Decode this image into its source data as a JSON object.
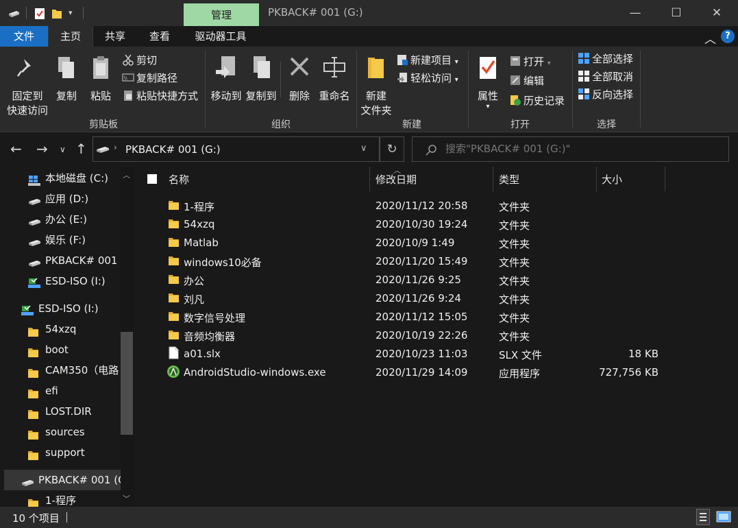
{
  "titlebar": {
    "manage_tab": "管理",
    "title": "PKBACK# 001 (G:)",
    "minimize": "—",
    "maximize": "☐",
    "close": "✕"
  },
  "menu": {
    "tabs": [
      "文件",
      "主页",
      "共享",
      "查看",
      "驱动器工具"
    ],
    "collapse": "^",
    "help": "?"
  },
  "ribbon": {
    "pin_label": "固定到\n快速访问",
    "copy": "复制",
    "paste": "粘贴",
    "cut": "剪切",
    "copy_path": "复制路径",
    "paste_shortcut": "粘贴快捷方式",
    "clipboard_group": "剪贴板",
    "move_to": "移动到",
    "copy_to": "复制到",
    "delete": "删除",
    "rename": "重命名",
    "organize_group": "组织",
    "new_folder": "新建\n文件夹",
    "new_item": "新建项目",
    "easy_access": "轻松访问",
    "new_group": "新建",
    "properties": "属性",
    "open": "打开",
    "edit": "编辑",
    "history": "历史记录",
    "open_group": "打开",
    "select_all": "全部选择",
    "select_none": "全部取消",
    "invert_selection": "反向选择",
    "select_group": "选择"
  },
  "address": {
    "path": "PKBACK# 001 (G:)",
    "search_placeholder": "搜索\"PKBACK# 001 (G:)\""
  },
  "sidebar": {
    "items": [
      {
        "label": "本地磁盘 (C:)",
        "icon": "windows-drive-icon"
      },
      {
        "label": "应用 (D:)",
        "icon": "drive-icon"
      },
      {
        "label": "办公 (E:)",
        "icon": "drive-icon"
      },
      {
        "label": "娱乐 (F:)",
        "icon": "drive-icon"
      },
      {
        "label": "PKBACK# 001 (",
        "icon": "drive-icon"
      },
      {
        "label": "ESD-ISO (I:)",
        "icon": "usb-drive-icon"
      },
      {
        "label": "ESD-ISO (I:)",
        "icon": "usb-drive-icon"
      },
      {
        "label": "54xzq",
        "icon": "folder-icon"
      },
      {
        "label": "boot",
        "icon": "folder-icon"
      },
      {
        "label": "CAM350（电路",
        "icon": "folder-icon"
      },
      {
        "label": "efi",
        "icon": "folder-icon"
      },
      {
        "label": "LOST.DIR",
        "icon": "folder-icon"
      },
      {
        "label": "sources",
        "icon": "folder-icon"
      },
      {
        "label": "support",
        "icon": "folder-icon"
      },
      {
        "label": "PKBACK# 001 (G",
        "icon": "drive-icon"
      },
      {
        "label": "1-程序",
        "icon": "folder-icon"
      }
    ]
  },
  "columns": {
    "name": "名称",
    "modified": "修改日期",
    "type": "类型",
    "size": "大小"
  },
  "files": [
    {
      "name": "1-程序",
      "modified": "2020/11/12 20:58",
      "type": "文件夹",
      "size": "",
      "icon": "folder-icon"
    },
    {
      "name": "54xzq",
      "modified": "2020/10/30 19:24",
      "type": "文件夹",
      "size": "",
      "icon": "folder-icon"
    },
    {
      "name": "Matlab",
      "modified": "2020/10/9 1:49",
      "type": "文件夹",
      "size": "",
      "icon": "folder-icon"
    },
    {
      "name": "windows10必备",
      "modified": "2020/11/20 15:49",
      "type": "文件夹",
      "size": "",
      "icon": "folder-icon"
    },
    {
      "name": "办公",
      "modified": "2020/11/26 9:25",
      "type": "文件夹",
      "size": "",
      "icon": "folder-icon"
    },
    {
      "name": "刘凡",
      "modified": "2020/11/26 9:24",
      "type": "文件夹",
      "size": "",
      "icon": "folder-icon"
    },
    {
      "name": "数字信号处理",
      "modified": "2020/11/12 15:05",
      "type": "文件夹",
      "size": "",
      "icon": "folder-icon"
    },
    {
      "name": "音频均衡器",
      "modified": "2020/10/19 22:26",
      "type": "文件夹",
      "size": "",
      "icon": "folder-icon"
    },
    {
      "name": "a01.slx",
      "modified": "2020/10/23 11:03",
      "type": "SLX 文件",
      "size": "18 KB",
      "icon": "file-icon"
    },
    {
      "name": "AndroidStudio-windows.exe",
      "modified": "2020/11/29 14:09",
      "type": "应用程序",
      "size": "727,756 KB",
      "icon": "android-studio-icon"
    }
  ],
  "status": {
    "count": "10 个项目"
  },
  "colors": {
    "accent": "#1a6fc4",
    "manage_tab": "#9fd8a4",
    "folder": "#f5c94a"
  }
}
